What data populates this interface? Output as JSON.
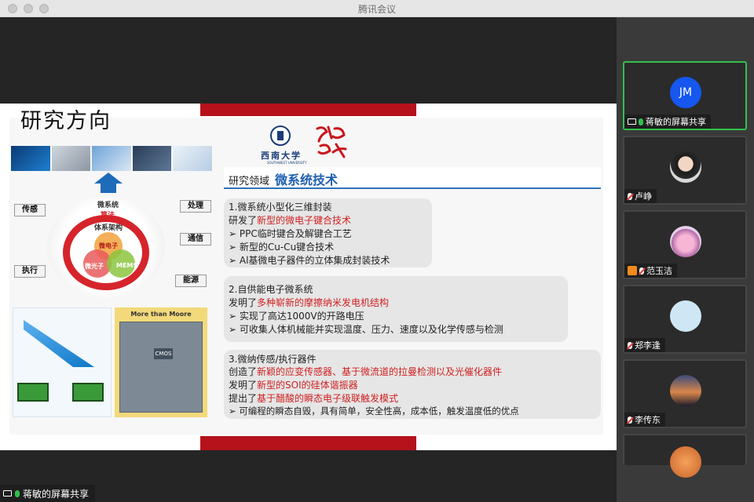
{
  "window": {
    "title": "腾讯会议"
  },
  "slide": {
    "title": "研究方向",
    "school_name": "西南大学",
    "school_name_en": "SOUTHWEST UNIVERSITY",
    "field_prefix": "研究领域",
    "field_main": "微系统技术",
    "diagram": {
      "top_label": "微系统",
      "ring_label": "算法",
      "core_label": "体系架构",
      "venn": [
        "微电子",
        "微光子",
        "MEMS"
      ],
      "tags": [
        "传感",
        "执行",
        "处理",
        "通信",
        "能源"
      ],
      "more_than_moore": "More than Moore",
      "cmos": "CMOS"
    },
    "sections": [
      {
        "heading": "1.微系统小型化三维封装",
        "lines": [
          {
            "prefix": "研发了",
            "highlight": "新型的微电子键合技术",
            "suffix": ""
          },
          {
            "prefix": "➢ PPC临时键合及解键合工艺",
            "highlight": "",
            "suffix": ""
          },
          {
            "prefix": "➢ 新型的Cu-Cu键合技术",
            "highlight": "",
            "suffix": ""
          },
          {
            "prefix": "➢ Al基微电子器件的立体集成封装技术",
            "highlight": "",
            "suffix": ""
          }
        ]
      },
      {
        "heading": "2.自供能电子微系统",
        "lines": [
          {
            "prefix": "发明了",
            "highlight": "多种崭新的摩擦纳米发电机结构",
            "suffix": ""
          },
          {
            "prefix": "➢ 实现了高达1000V的开路电压",
            "highlight": "",
            "suffix": ""
          },
          {
            "prefix": "➢ 可收集人体机械能并实现温度、压力、速度以及化学传感与检测",
            "highlight": "",
            "suffix": ""
          }
        ]
      },
      {
        "heading": "3.微纳传感/执行器件",
        "lines": [
          {
            "prefix": "创造了",
            "highlight": "新颖的应变传感器、基于微流道的拉曼检测以及光催化器件",
            "suffix": ""
          },
          {
            "prefix": "发明了",
            "highlight": "新型的SOI的硅体谐振器",
            "suffix": ""
          },
          {
            "prefix": "提出了",
            "highlight": "基于醋酸的瞬态电子级联触发模式",
            "suffix": ""
          },
          {
            "prefix": "➢ 可编程的瞬态自毁，具有简单，安全性高，成本低，触发温度低的优点",
            "highlight": "",
            "suffix": ""
          }
        ]
      }
    ]
  },
  "participants": [
    {
      "avatar_text": "JM",
      "name": "蒋敏的屏幕共享",
      "mic": "on",
      "screen_share": true,
      "active": true,
      "avatar": "initials"
    },
    {
      "avatar_text": "",
      "name": "卢峥",
      "mic": "off",
      "avatar": "photo"
    },
    {
      "avatar_text": "",
      "name": "范玉洁",
      "mic": "off",
      "avatar": "cat",
      "extra_icon": "person-icon"
    },
    {
      "avatar_text": "",
      "name": "郑李逢",
      "mic": "off",
      "avatar": "plain"
    },
    {
      "avatar_text": "",
      "name": "李传东",
      "mic": "off",
      "avatar": "scene"
    }
  ],
  "bottom_share_label": "蒋敏的屏幕共享"
}
